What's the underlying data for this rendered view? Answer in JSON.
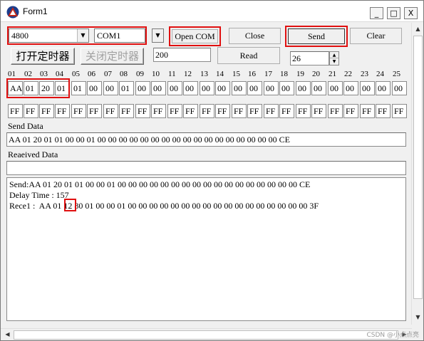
{
  "window": {
    "title": "Form1",
    "minimize": "_",
    "maximize": "□",
    "close": "X"
  },
  "controls": {
    "baud": "4800",
    "port": "COM1",
    "open_com": "Open COM",
    "close": "Close",
    "send": "Send",
    "clear": "Clear",
    "start_timer": "打开定时器",
    "stop_timer": "关闭定时器",
    "interval": "200",
    "read": "Read",
    "count": "26"
  },
  "grid": {
    "indices": [
      "01",
      "02",
      "03",
      "04",
      "05",
      "06",
      "07",
      "08",
      "09",
      "10",
      "11",
      "12",
      "13",
      "14",
      "15",
      "16",
      "17",
      "18",
      "19",
      "20",
      "21",
      "22",
      "23",
      "24",
      "25"
    ],
    "row1": [
      "AA",
      "01",
      "20",
      "01",
      "01",
      "00",
      "00",
      "01",
      "00",
      "00",
      "00",
      "00",
      "00",
      "00",
      "00",
      "00",
      "00",
      "00",
      "00",
      "00",
      "00",
      "00",
      "00",
      "00",
      "00"
    ],
    "row2": [
      "FF",
      "FF",
      "FF",
      "FF",
      "FF",
      "FF",
      "FF",
      "FF",
      "FF",
      "FF",
      "FF",
      "FF",
      "FF",
      "FF",
      "FF",
      "FF",
      "FF",
      "FF",
      "FF",
      "FF",
      "FF",
      "FF",
      "FF",
      "FF",
      "FF"
    ]
  },
  "send_data": {
    "label": "Send Data",
    "value": "AA 01 20 01 01 00 00 01 00 00 00 00 00 00 00 00 00 00 00 00 00 00 00 00 00 CE"
  },
  "received_data": {
    "label": "Reaeived Data",
    "value": ""
  },
  "log": {
    "send_line": "Send:AA 01 20 01 01 00 00 01 00 00 00 00 00 00 00 00 00 00 00 00 00 00 00 00 00 CE",
    "delay_line": "Delay Time : 157",
    "rece_prefix": "Rece1 :  AA 01 ",
    "rece_highlight": "12",
    "rece_suffix": " 80 01 00 00 01 00 00 00 00 00 00 00 00 00 00 00 00 00 00 00 00 00 3F"
  },
  "watermark": "CSDN @小点点亮",
  "colors": {
    "highlight_box": "#e01010",
    "window_bg": "#f0f0f0",
    "icon_red": "#c0281a",
    "icon_blue": "#1c3d8c"
  }
}
